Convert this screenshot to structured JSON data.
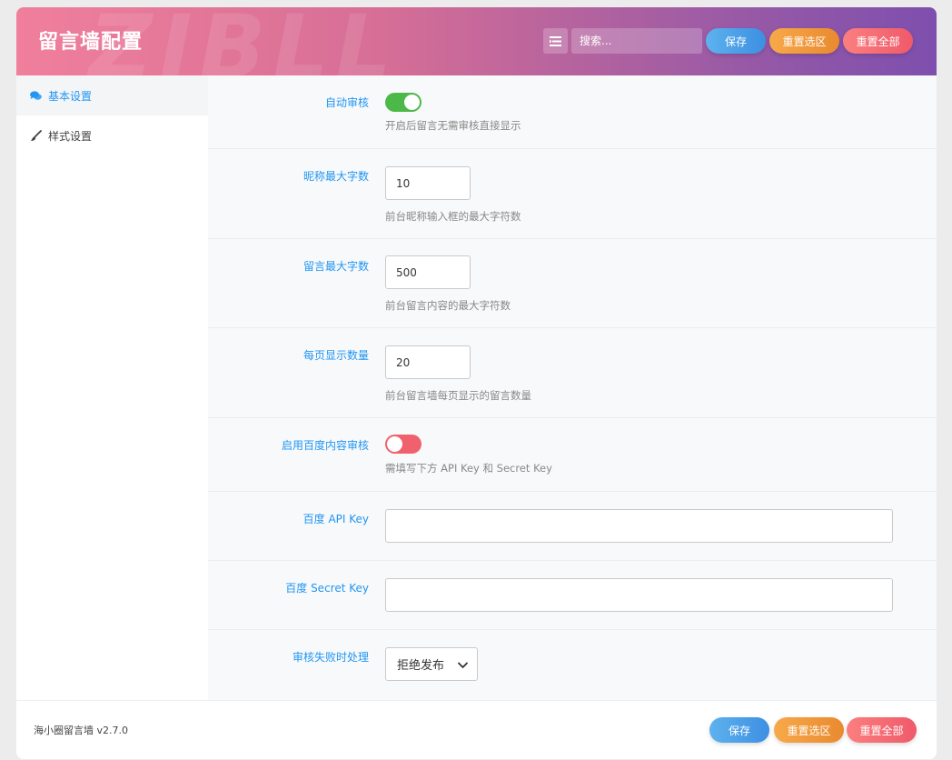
{
  "header": {
    "title": "留言墙配置",
    "watermark": "ZIBLL",
    "search_placeholder": "搜索...",
    "save_label": "保存",
    "reset_section_label": "重置选区",
    "reset_all_label": "重置全部"
  },
  "sidebar": {
    "items": [
      {
        "label": "基本设置",
        "icon": "comments-icon",
        "active": true
      },
      {
        "label": "样式设置",
        "icon": "paintbrush-icon",
        "active": false
      }
    ]
  },
  "settings": {
    "auto_review": {
      "label": "自动审核",
      "enabled": true,
      "desc": "开启后留言无需审核直接显示"
    },
    "nickname_max": {
      "label": "昵称最大字数",
      "value": "10",
      "desc": "前台昵称输入框的最大字符数"
    },
    "message_max": {
      "label": "留言最大字数",
      "value": "500",
      "desc": "前台留言内容的最大字符数"
    },
    "per_page": {
      "label": "每页显示数量",
      "value": "20",
      "desc": "前台留言墙每页显示的留言数量"
    },
    "baidu_review": {
      "label": "启用百度内容审核",
      "enabled": false,
      "desc": "需填写下方 API Key 和 Secret Key"
    },
    "baidu_api_key": {
      "label": "百度 API Key",
      "value": ""
    },
    "baidu_secret_key": {
      "label": "百度 Secret Key",
      "value": ""
    },
    "review_fail_action": {
      "label": "审核失败时处理",
      "selected": "拒绝发布"
    }
  },
  "footer": {
    "version": "海小圈留言墙 v2.7.0",
    "save_label": "保存",
    "reset_section_label": "重置选区",
    "reset_all_label": "重置全部"
  },
  "colors": {
    "accent_blue": "#2196f3",
    "toggle_on": "#4cb848",
    "toggle_off": "#f0616e"
  }
}
